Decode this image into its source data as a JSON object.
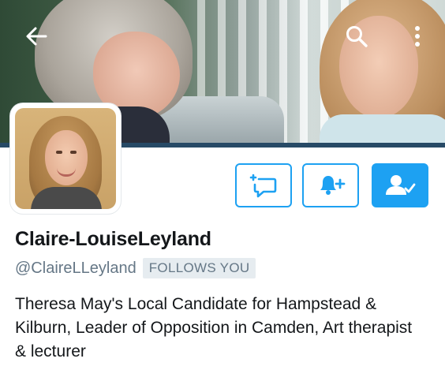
{
  "header": {
    "back_icon": "arrow-left-icon",
    "search_icon": "search-icon",
    "more_icon": "more-vertical-icon"
  },
  "profile": {
    "display_name": "Claire-LouiseLeyland",
    "handle": "@ClaireLLeyland",
    "follows_you_badge": "FOLLOWS YOU",
    "bio": "Theresa May's Local Candidate for Hampstead & Kilburn, Leader of Opposition in Camden, Art therapist & lecturer"
  },
  "actions": {
    "direct_message_icon": "compose-message-icon",
    "notifications_icon": "bell-plus-icon",
    "following_icon": "user-check-icon"
  },
  "colors": {
    "accent": "#1da1f2",
    "text_primary": "#14171a",
    "text_secondary": "#657786",
    "badge_bg": "#e6ecf0"
  }
}
